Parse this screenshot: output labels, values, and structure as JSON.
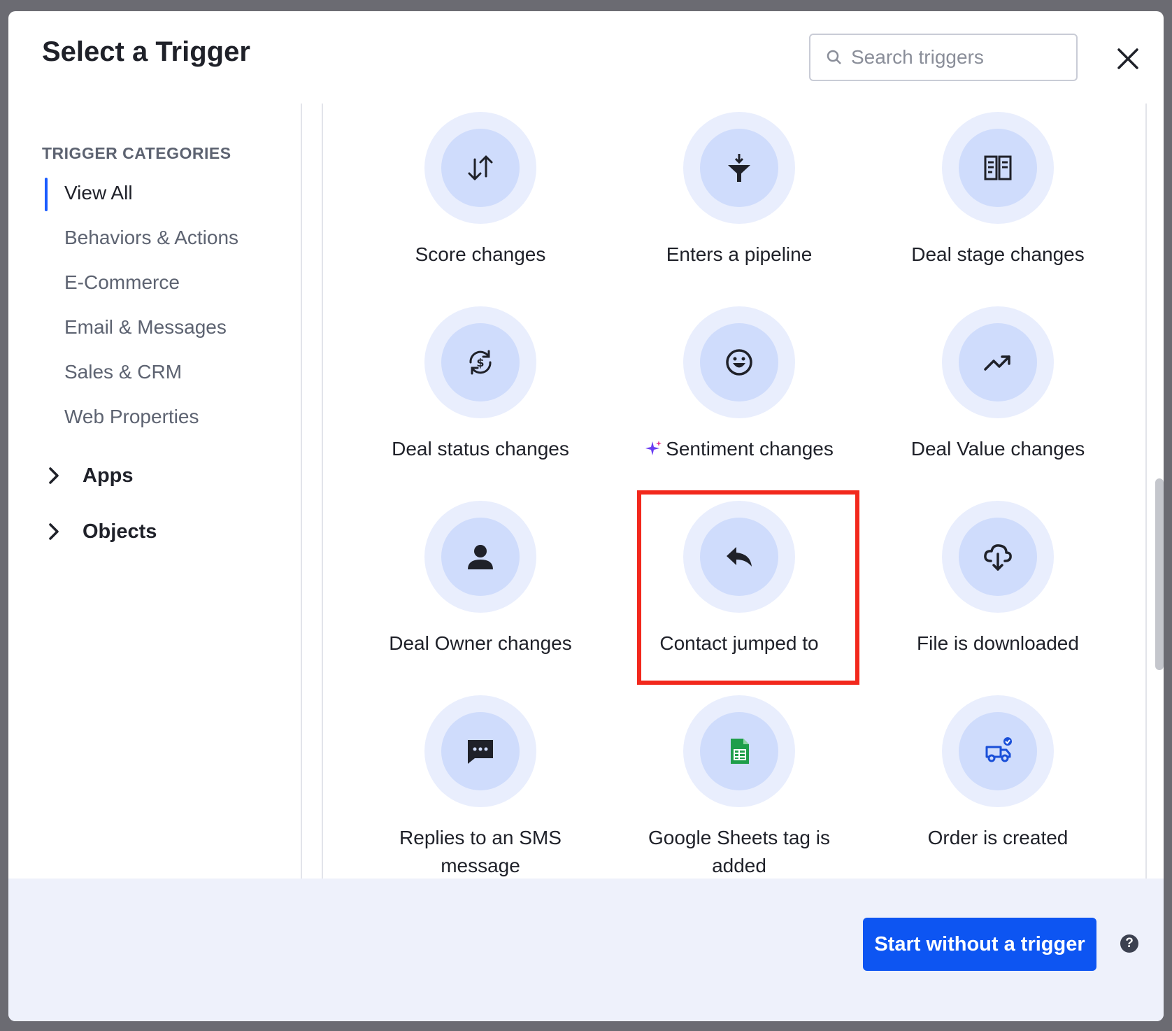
{
  "modal": {
    "title": "Select a Trigger",
    "search_placeholder": "Search triggers"
  },
  "sidebar": {
    "heading": "TRIGGER CATEGORIES",
    "categories": [
      {
        "label": "View All",
        "active": true
      },
      {
        "label": "Behaviors & Actions"
      },
      {
        "label": "E-Commerce"
      },
      {
        "label": "Email & Messages"
      },
      {
        "label": "Sales & CRM"
      },
      {
        "label": "Web Properties"
      }
    ],
    "groups": [
      {
        "label": "Apps"
      },
      {
        "label": "Objects"
      }
    ]
  },
  "triggers": [
    {
      "label": "Score changes",
      "icon": "arrows-up-down-icon"
    },
    {
      "label": "Enters a pipeline",
      "icon": "funnel-icon"
    },
    {
      "label": "Deal stage changes",
      "icon": "kanban-columns-icon"
    },
    {
      "label": "Deal status changes",
      "icon": "dollar-cycle-icon"
    },
    {
      "label": "Sentiment changes",
      "icon": "smiley-face-icon",
      "badge": "sparkle-icon"
    },
    {
      "label": "Deal Value changes",
      "icon": "trending-up-icon"
    },
    {
      "label": "Deal Owner changes",
      "icon": "person-icon"
    },
    {
      "label": "Contact jumped to",
      "icon": "reply-arrow-icon",
      "highlighted": true
    },
    {
      "label": "File is downloaded",
      "icon": "cloud-download-icon"
    },
    {
      "label": "Replies to an SMS message",
      "icon": "chat-bubble-icon"
    },
    {
      "label": "Google Sheets tag is added",
      "icon": "google-sheets-icon"
    },
    {
      "label": "Order is created",
      "icon": "delivery-truck-icon"
    }
  ],
  "footer": {
    "primary_button": "Start without a trigger",
    "help_symbol": "?"
  },
  "colors": {
    "accent": "#0d55f2",
    "highlight_border": "#f2281c",
    "icon_outer": "#e9eefd",
    "icon_inner": "#cfdcfc"
  }
}
